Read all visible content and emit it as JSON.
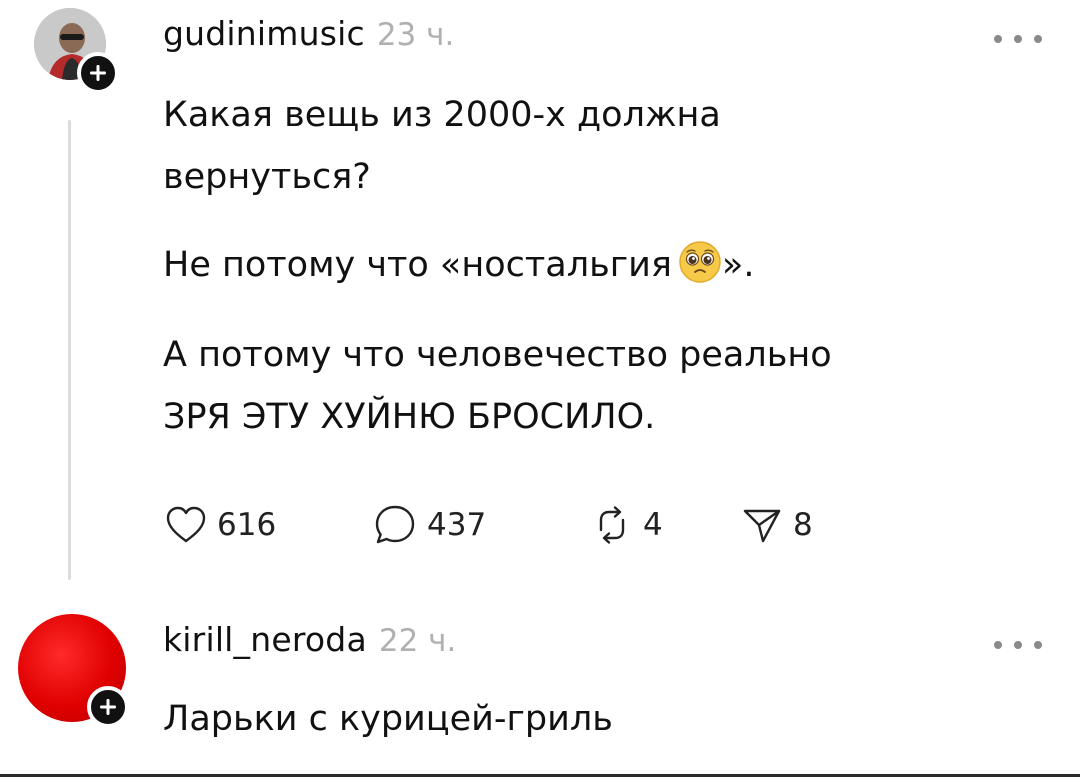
{
  "post": {
    "username": "gudinimusic",
    "timestamp": "23 ч.",
    "lines": [
      "Какая вещь из 2000-х должна",
      "вернуться?",
      "Не потому что «ностальгия",
      "А потому что человечество реально",
      "ЗРЯ ЭТУ ХУЙНЮ БРОСИЛО."
    ],
    "line3_suffix": "».",
    "emoji": "pleading-face-emoji",
    "stats": {
      "likes": "616",
      "comments": "437",
      "reposts": "4",
      "shares": "8"
    }
  },
  "reply": {
    "username": "kirill_neroda",
    "timestamp": "22 ч.",
    "text": "Ларьки с курицей-гриль"
  },
  "icons": {
    "follow": "plus-icon",
    "more": "more-dots-icon",
    "like": "heart-icon",
    "comment": "comment-bubble-icon",
    "repost": "repost-icon",
    "share": "send-icon"
  },
  "colors": {
    "text": "#111111",
    "timestamp": "#b0b0b0",
    "reply_avatar": "#e00000"
  }
}
